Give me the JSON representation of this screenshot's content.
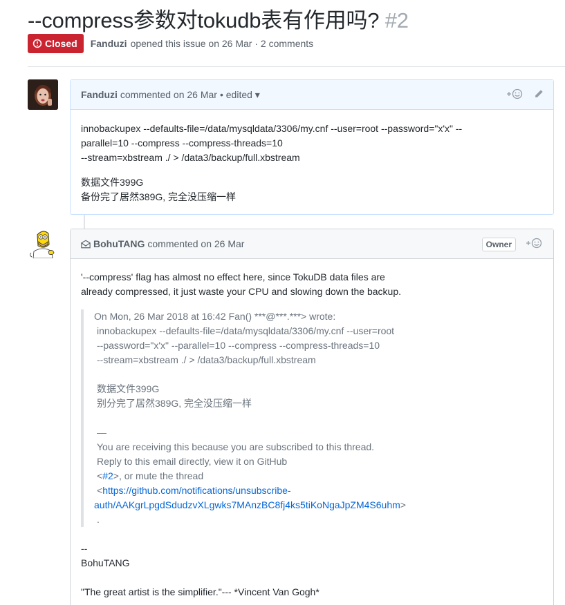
{
  "issue": {
    "title": "--compress参数对tokudb表有作用吗?",
    "number": "#2",
    "state": "Closed",
    "author": "Fanduzi",
    "meta_text": "opened this issue on 26 Mar · 2 comments"
  },
  "comments": [
    {
      "author": "Fanduzi",
      "action": "commented on 26 Mar",
      "edited": "• edited ▾",
      "body": {
        "cmd_line1": "innobackupex --defaults-file=/data/mysqldata/3306/my.cnf --user=root --password=\"x'x\" --",
        "cmd_line2": "parallel=10 --compress --compress-threads=10",
        "cmd_line3": "--stream=xbstream ./ > /data3/backup/full.xbstream",
        "note_line1": "数据文件399G",
        "note_line2": "备份完了居然389G, 完全没压缩一样"
      }
    },
    {
      "author": "BohuTANG",
      "action": "commented on 26 Mar",
      "owner_label": "Owner",
      "body": {
        "reply_line1": "'--compress' flag has almost no effect here, since TokuDB data files are",
        "reply_line2": "already compressed, it just waste your CPU and slowing down the backup.",
        "quote_header": "On Mon, 26 Mar 2018 at 16:42 Fan() ***@***.***> wrote:",
        "quote_cmd1": "innobackupex --defaults-file=/data/mysqldata/3306/my.cnf --user=root",
        "quote_cmd2": "--password=\"x'x\" --parallel=10 --compress --compress-threads=10",
        "quote_cmd3": "--stream=xbstream ./ > /data3/backup/full.xbstream",
        "quote_note1": "数据文件399G",
        "quote_note2": "别分完了居然389G, 完全没压缩一样",
        "quote_dash": "—",
        "quote_recv": "You are receiving this because you are subscribed to this thread.",
        "quote_reply": "Reply to this email directly, view it on GitHub",
        "quote_lt": "<",
        "quote_issue_link": "#2",
        "quote_mute": ">, or mute the thread",
        "quote_lt2": "<",
        "quote_unsub_link1": "https://github.com/notifications/unsubscribe-",
        "quote_unsub_link2": "auth/AAKgrLpgdSdudzvXLgwks7MAnzBC8fj4ks5tiKoNgaJpZM4S6uhm",
        "quote_gt": ">",
        "quote_dot": ".",
        "sig_dash": "--",
        "sig_name": "BohuTANG",
        "sig_quote": "\"The great artist is the simplifier.\"--- *Vincent Van Gogh*"
      }
    }
  ],
  "colors": {
    "closed_badge": "#cb2431",
    "link": "#0366d6",
    "muted": "#586069"
  }
}
